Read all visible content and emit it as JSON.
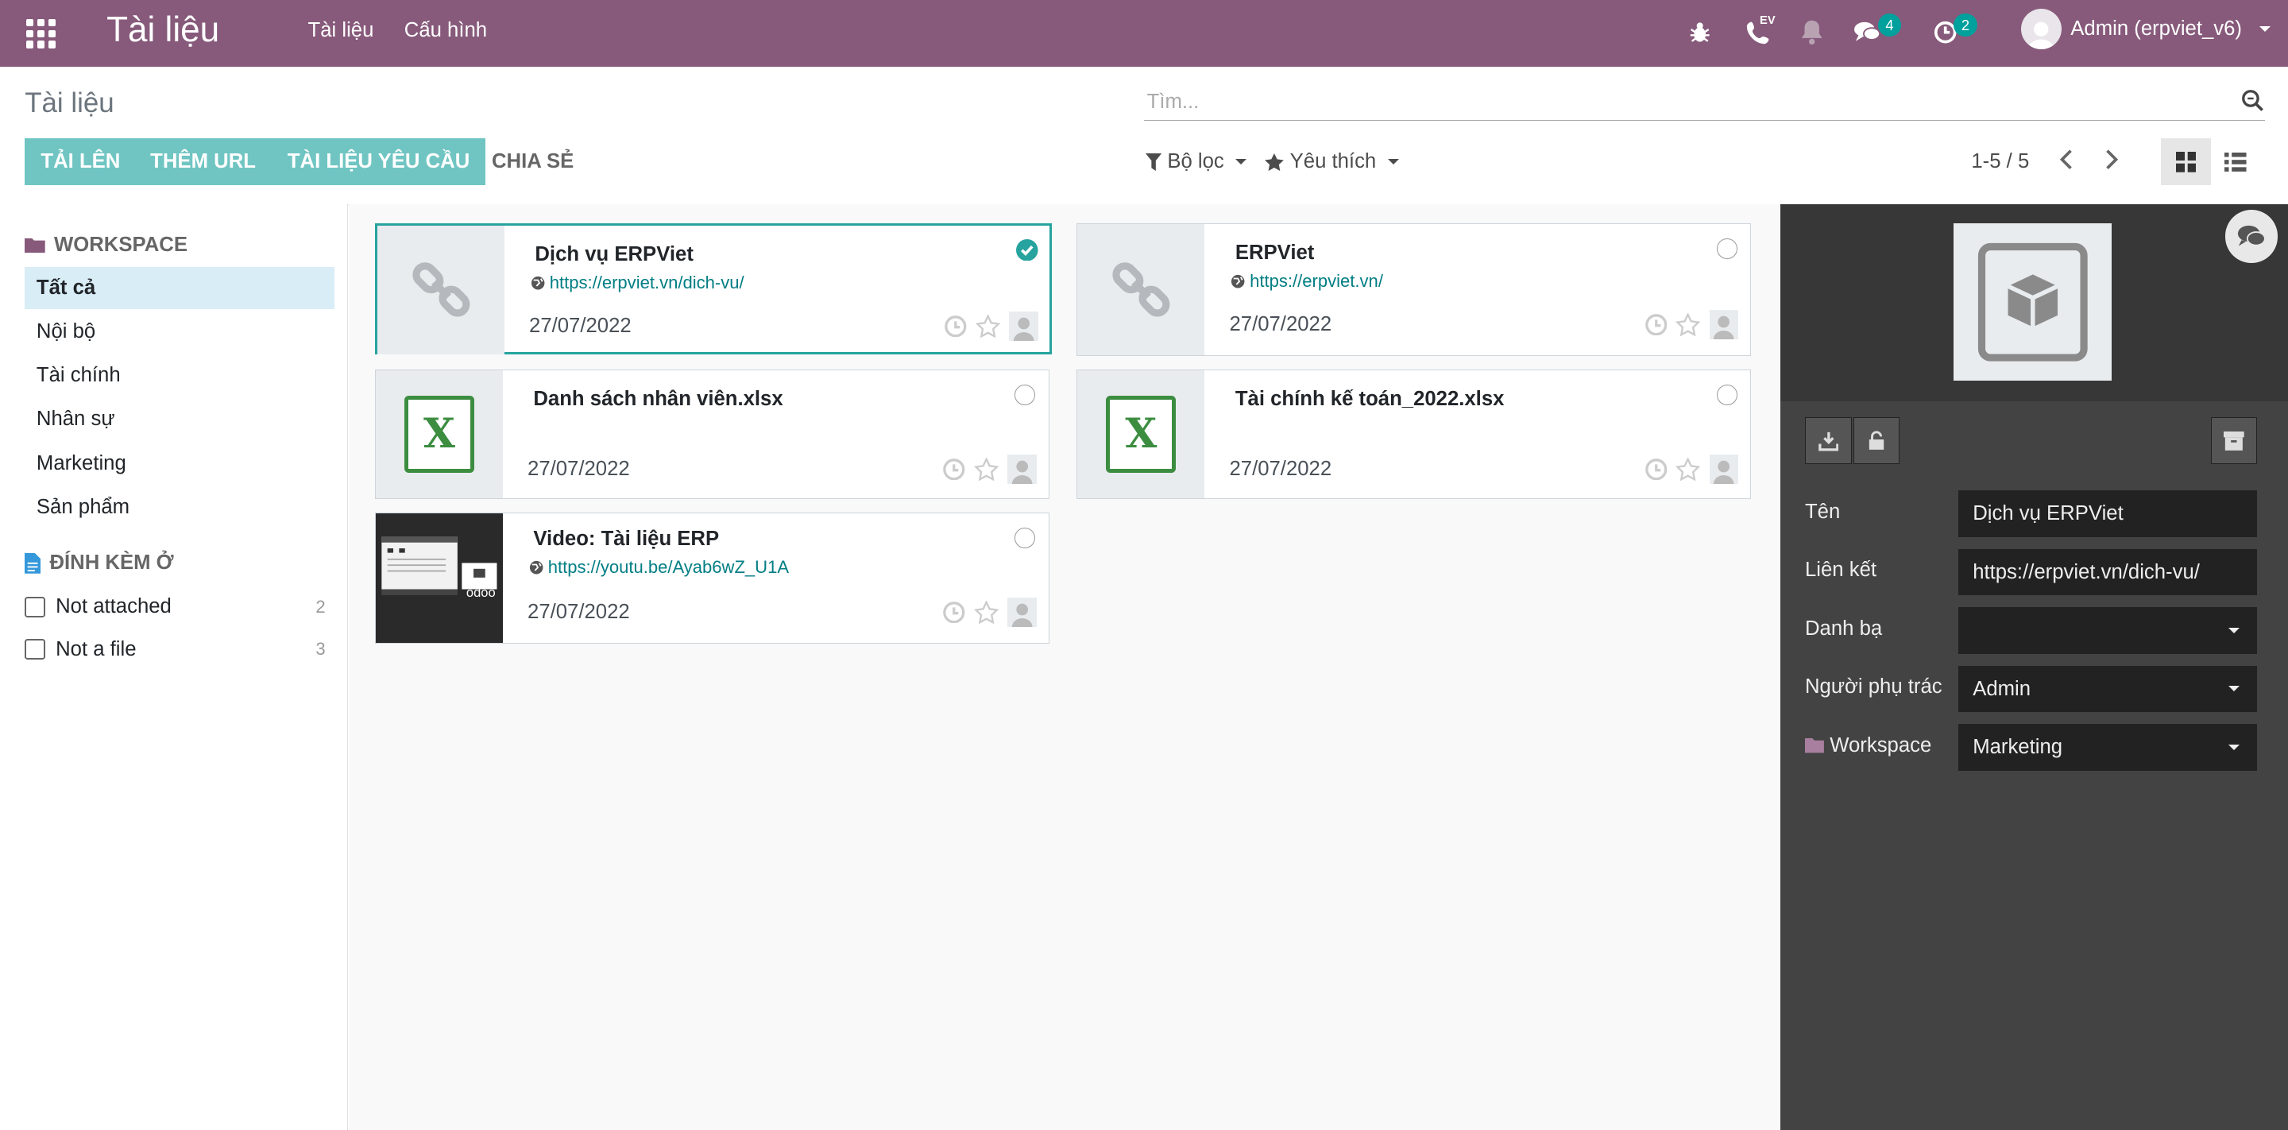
{
  "topbar": {
    "app_title": "Tài liệu",
    "menu": [
      "Tài liệu",
      "Cấu hình"
    ],
    "voip_tag": "EV",
    "messages_count": "4",
    "activities_count": "2",
    "user_name": "Admin (erpviet_v6)",
    "color": "#875a7b"
  },
  "control": {
    "breadcrumb": "Tài liệu",
    "search_placeholder": "Tìm...",
    "buttons": [
      "TẢI LÊN",
      "THÊM URL",
      "TÀI LIỆU YÊU CẦU",
      "CHIA SẺ"
    ],
    "filter_label": "Bộ lọc",
    "favorites_label": "Yêu thích",
    "pager": "1-5 / 5",
    "accent": "#70c5c2"
  },
  "sidebar": {
    "workspace_header": "WORKSPACE",
    "workspaces": [
      "Tất cả",
      "Nội bộ",
      "Tài chính",
      "Nhân sự",
      "Marketing",
      "Sản phẩm"
    ],
    "attached_header": "ĐÍNH KÈM Ở",
    "facets": [
      {
        "label": "Not attached",
        "count": "2"
      },
      {
        "label": "Not a file",
        "count": "3"
      }
    ]
  },
  "cards": [
    {
      "title": "Dịch vụ ERPViet",
      "url": "https://erpviet.vn/dich-vu/",
      "date": "27/07/2022",
      "thumb": "link-icon",
      "selected": true
    },
    {
      "title": "ERPViet",
      "url": "https://erpviet.vn/",
      "date": "27/07/2022",
      "thumb": "link-icon",
      "selected": false
    },
    {
      "title": "Danh sách nhân viên.xlsx",
      "url": "",
      "date": "27/07/2022",
      "thumb": "excel-icon",
      "selected": false
    },
    {
      "title": "Tài chính kế toán_2022.xlsx",
      "url": "",
      "date": "27/07/2022",
      "thumb": "excel-icon",
      "selected": false
    },
    {
      "title": "Video: Tài liệu ERP",
      "url": "https://youtu.be/Ayab6wZ_U1A",
      "date": "27/07/2022",
      "thumb": "video-thumbnail",
      "selected": false
    }
  ],
  "video_thumb_text": "odoo",
  "excel_letter": "X",
  "panel": {
    "fields": [
      {
        "label": "Tên",
        "value": "Dịch vụ ERPViet"
      },
      {
        "label": "Liên kết",
        "value": "https://erpviet.vn/dich-vu/"
      },
      {
        "label": "Danh bạ",
        "value": ""
      },
      {
        "label": "Người phụ trác",
        "value": "Admin"
      },
      {
        "label": "Workspace",
        "value": "Marketing"
      }
    ]
  }
}
